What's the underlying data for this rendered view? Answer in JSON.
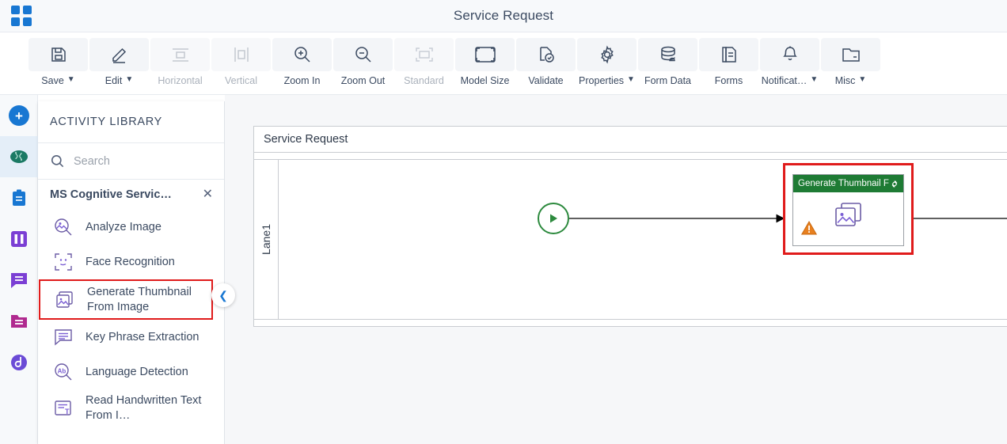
{
  "header": {
    "title": "Service Request",
    "app_menu_icon": "grid-icon"
  },
  "toolbar": {
    "items": [
      {
        "label": "Save",
        "icon": "save-icon",
        "caret": true,
        "disabled": false
      },
      {
        "label": "Edit",
        "icon": "pencil-icon",
        "caret": true,
        "disabled": false
      },
      {
        "label": "Horizontal",
        "icon": "horizontal-icon",
        "caret": false,
        "disabled": true
      },
      {
        "label": "Vertical",
        "icon": "vertical-icon",
        "caret": false,
        "disabled": true
      },
      {
        "label": "Zoom In",
        "icon": "zoom-in-icon",
        "caret": false,
        "disabled": false
      },
      {
        "label": "Zoom Out",
        "icon": "zoom-out-icon",
        "caret": false,
        "disabled": false
      },
      {
        "label": "Standard",
        "icon": "standard-icon",
        "caret": false,
        "disabled": true
      },
      {
        "label": "Model Size",
        "icon": "model-size-icon",
        "caret": false,
        "disabled": false
      },
      {
        "label": "Validate",
        "icon": "validate-icon",
        "caret": false,
        "disabled": false
      },
      {
        "label": "Properties",
        "icon": "gear-icon",
        "caret": true,
        "disabled": false
      },
      {
        "label": "Form Data",
        "icon": "database-icon",
        "caret": false,
        "disabled": false
      },
      {
        "label": "Forms",
        "icon": "forms-icon",
        "caret": false,
        "disabled": false
      },
      {
        "label": "Notificat…",
        "icon": "bell-icon",
        "caret": true,
        "disabled": false
      },
      {
        "label": "Misc",
        "icon": "folder-icon",
        "caret": true,
        "disabled": false
      }
    ]
  },
  "rail": {
    "items": [
      {
        "name": "add-button",
        "icon": "plus-icon",
        "color": "#1877d2",
        "active": false
      },
      {
        "name": "cognitive-services",
        "icon": "brain-icon",
        "color": "#1b7a64",
        "active": true
      },
      {
        "name": "tasks",
        "icon": "clipboard-icon",
        "color": "#1877d2",
        "active": false
      },
      {
        "name": "columns",
        "icon": "columns-icon",
        "color": "#7b3fd4",
        "active": false
      },
      {
        "name": "messages",
        "icon": "chat-icon",
        "color": "#7b3fd4",
        "active": false
      },
      {
        "name": "documents",
        "icon": "folder-doc-icon",
        "color": "#b02a8f",
        "active": false
      },
      {
        "name": "integrations",
        "icon": "swirl-icon",
        "color": "#6b4bd6",
        "active": false
      }
    ]
  },
  "panel": {
    "title": "ACTIVITY LIBRARY",
    "search": {
      "placeholder": "Search",
      "value": "",
      "icon": "search-icon"
    },
    "group": {
      "label": "MS Cognitive Servic…",
      "close_icon": "close-icon"
    },
    "activities": [
      {
        "label": "Analyze Image",
        "icon": "analyze-image-icon",
        "selected": false
      },
      {
        "label": "Face Recognition",
        "icon": "face-icon",
        "selected": false
      },
      {
        "label": "Generate Thumbnail From Image",
        "icon": "thumbnail-icon",
        "selected": true
      },
      {
        "label": "Key Phrase Extraction",
        "icon": "key-phrase-icon",
        "selected": false
      },
      {
        "label": "Language Detection",
        "icon": "language-icon",
        "selected": false
      },
      {
        "label": "Read Handwritten Text From I…",
        "icon": "handwritten-icon",
        "selected": false
      }
    ],
    "collapse_icon": "chevron-left-icon"
  },
  "canvas": {
    "pool_title": "Service Request",
    "lane_label": "Lane1",
    "start_node": {
      "name": "start-event",
      "color": "#2d8a3e"
    },
    "end_node": {
      "name": "end-event",
      "color": "#bf3030"
    },
    "task": {
      "title": "Generate Thumbnail F…",
      "header_color": "#1e7b34",
      "gear_icon": "gear-icon",
      "warning_icon": "warning-icon",
      "body_icon": "thumbnail-icon",
      "selected": true,
      "selection_color": "#e01b1b"
    }
  }
}
